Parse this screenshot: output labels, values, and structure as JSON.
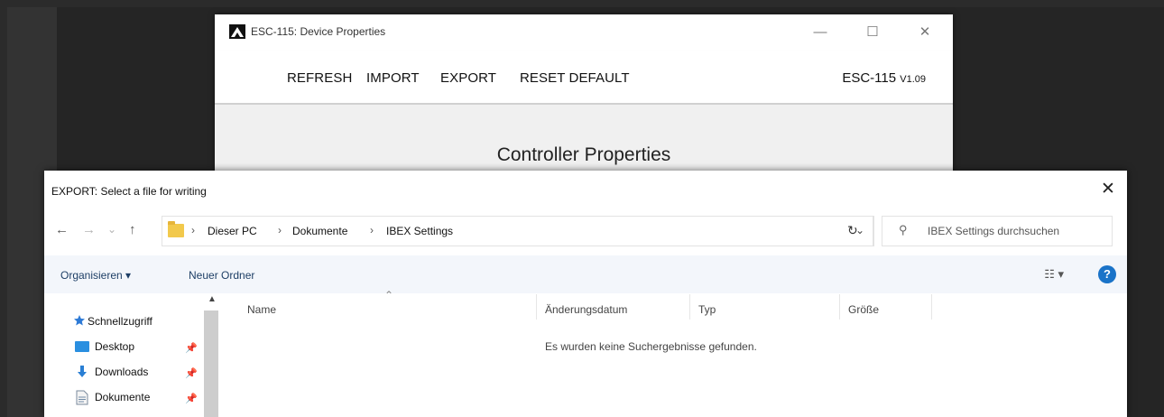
{
  "device_window": {
    "title": "ESC-115: Device Properties",
    "controls": {
      "minimize": "—",
      "maximize": "☐",
      "close": "✕"
    },
    "toolbar": {
      "refresh": "REFRESH",
      "import": "IMPORT",
      "export": "EXPORT",
      "reset_default": "RESET DEFAULT"
    },
    "model": "ESC-115",
    "version": "V1.09",
    "section_heading": "Controller Properties"
  },
  "dialog": {
    "title": "EXPORT: Select a file for writing",
    "close": "✕",
    "nav": {
      "back": "←",
      "forward": "→",
      "recent": "⌄",
      "up": "↑"
    },
    "breadcrumb": [
      {
        "label": "Dieser PC"
      },
      {
        "label": "Dokumente"
      },
      {
        "label": "IBEX Settings"
      }
    ],
    "breadcrumb_separator": "›",
    "address_dropdown": "⌄",
    "refresh_icon": "↻",
    "search_icon": "⚲",
    "search_placeholder": "IBEX Settings durchsuchen",
    "commands": {
      "organize": "Organisieren ▾",
      "new_folder": "Neuer Ordner",
      "view": "☷ ▾",
      "help": "?"
    },
    "columns": {
      "name": "Name",
      "modified": "Änderungsdatum",
      "type": "Typ",
      "size": "Größe"
    },
    "empty_message": "Es wurden keine Suchergebnisse gefunden.",
    "nav_pane": {
      "quick_access": "Schnellzugriff",
      "items": [
        {
          "label": "Desktop",
          "pin": "📌"
        },
        {
          "label": "Downloads",
          "pin": "📌"
        },
        {
          "label": "Dokumente",
          "pin": "📌"
        }
      ]
    }
  },
  "colors": {
    "accent_blue": "#1a73c8",
    "folder_yellow": "#f2c94c",
    "background_dark": "#252525"
  }
}
